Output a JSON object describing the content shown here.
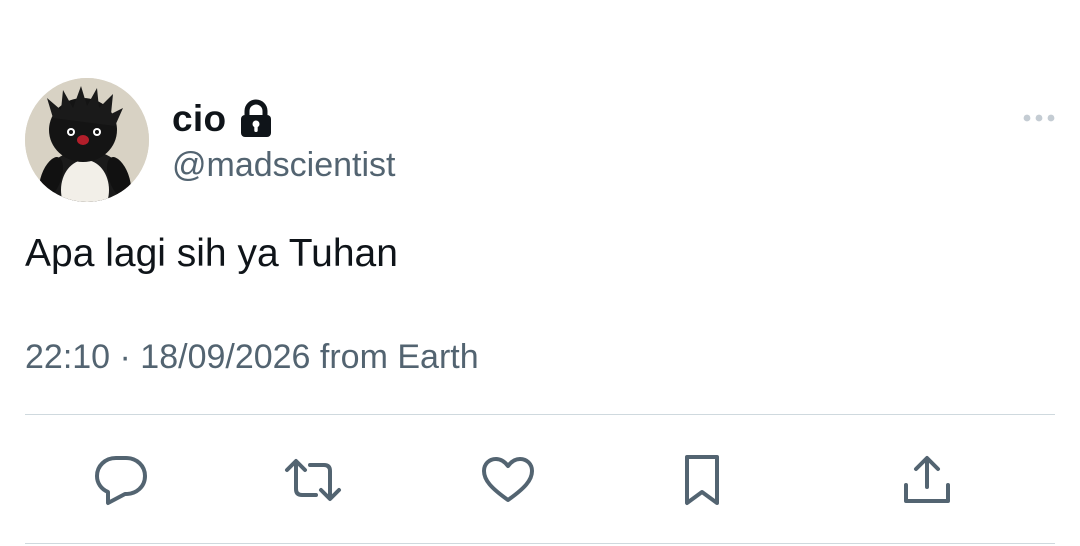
{
  "author": {
    "display_name": "cio",
    "handle": "@madscientist",
    "protected": true,
    "avatar": "penguin-plush-avatar"
  },
  "tweet": {
    "text": "Apa lagi sih ya Tuhan",
    "time": "22:10",
    "date": "18/09/2026",
    "source": "from Earth",
    "meta_line": "22:10 · 18/09/2026 from Earth"
  },
  "actions": [
    {
      "name": "reply",
      "icon": "reply-icon"
    },
    {
      "name": "retweet",
      "icon": "retweet-icon"
    },
    {
      "name": "like",
      "icon": "heart-icon"
    },
    {
      "name": "bookmark",
      "icon": "bookmark-icon"
    },
    {
      "name": "share",
      "icon": "share-icon"
    }
  ],
  "colors": {
    "text_primary": "#0f1419",
    "text_secondary": "#536471",
    "icon_gray": "#536471",
    "divider": "#cfd9de"
  }
}
